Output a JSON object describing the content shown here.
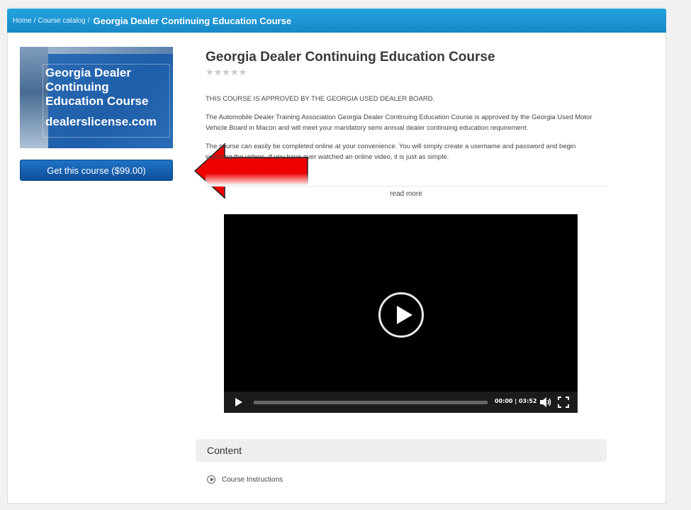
{
  "breadcrumb": {
    "home": "Home",
    "catalog": "Course catalog",
    "separator": "/",
    "current": "Georgia Dealer Continuing Education Course"
  },
  "thumbnail": {
    "title": "Georgia Dealer Continuing Education Course",
    "site": "dealerslicense.com"
  },
  "buy_button": {
    "label": "Get this course ($99.00)"
  },
  "course": {
    "title": "Georgia Dealer Continuing Education Course",
    "rating_stars": "★★★★★",
    "rating_value": 0,
    "description": [
      "THIS COURSE IS APPROVED BY THE GEORGIA USED DEALER BOARD.",
      "The Automobile Dealer Training Association Georgia Dealer Continuing Education Course is approved by the Georgia Used Motor Vehicle Board in Macon and will meet your mandatory semi annual dealer continuing education requirement.",
      "The course can easily be completed online at your convenience. You will simply create a username and password and begin watching the videos. If you have ever watched an online video, it is just as simple."
    ],
    "read_more": "read more"
  },
  "video": {
    "time": "00:00 | 03:52",
    "progress": 0
  },
  "content": {
    "header": "Content",
    "items": [
      {
        "label": "Course Instructions"
      }
    ]
  },
  "colors": {
    "breadcrumb_bar": "#1f97d6",
    "buy_button": "#145fae",
    "arrow": "#ee0000"
  }
}
